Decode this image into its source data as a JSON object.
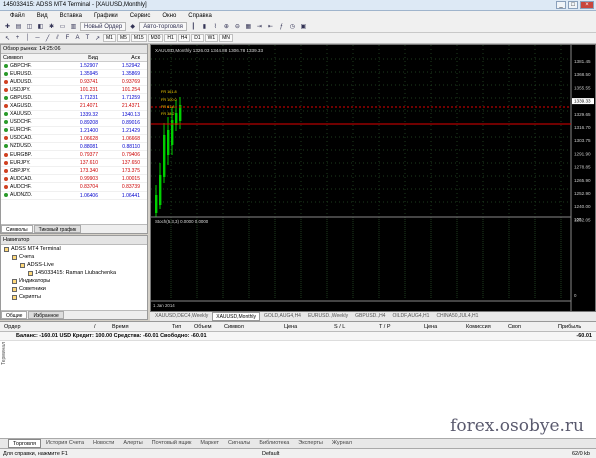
{
  "window": {
    "title": "145033415: ADSS MT4 Terminal - [XAUUSD,Monthly]",
    "buttons": [
      "_",
      "□",
      "×"
    ]
  },
  "menu": [
    "Файл",
    "Вид",
    "Вставка",
    "Графики",
    "Сервис",
    "Окно",
    "Справка"
  ],
  "toolbar": {
    "new_order": "Новый Ордер",
    "autotrade": "Авто-торговля"
  },
  "timeframes": [
    "M1",
    "M5",
    "M15",
    "M30",
    "H1",
    "H4",
    "D1",
    "W1",
    "MN"
  ],
  "market_watch": {
    "title": "Обзор рынка: 14:25:06",
    "headers": [
      "Символ",
      "Бид",
      "Аск"
    ],
    "rows": [
      {
        "sym": "GBPCHF.",
        "bid": "1.52907",
        "ask": "1.52942",
        "dir": "up"
      },
      {
        "sym": "EURUSD.",
        "bid": "1.35945",
        "ask": "1.35869",
        "dir": "up"
      },
      {
        "sym": "AUDUSD.",
        "bid": "0.93741",
        "ask": "0.93769",
        "dir": "dn"
      },
      {
        "sym": "USDJPY.",
        "bid": "101.231",
        "ask": "101.254",
        "dir": "dn"
      },
      {
        "sym": "GBPUSD.",
        "bid": "1.71231",
        "ask": "1.71259",
        "dir": "up"
      },
      {
        "sym": "XAGUSD.",
        "bid": "21.4071",
        "ask": "21.4371",
        "dir": "dn"
      },
      {
        "sym": "XAUUSD.",
        "bid": "1339.32",
        "ask": "1340.13",
        "dir": "up"
      },
      {
        "sym": "USDCHF.",
        "bid": "0.89208",
        "ask": "0.89016",
        "dir": "up"
      },
      {
        "sym": "EURCHF.",
        "bid": "1.21400",
        "ask": "1.21429",
        "dir": "up"
      },
      {
        "sym": "USDCAD.",
        "bid": "1.06628",
        "ask": "1.06668",
        "dir": "dn"
      },
      {
        "sym": "NZDUSD.",
        "bid": "0.88081",
        "ask": "0.88110",
        "dir": "up"
      },
      {
        "sym": "EURGBP.",
        "bid": "0.79377",
        "ask": "0.79406",
        "dir": "dn"
      },
      {
        "sym": "EURJPY.",
        "bid": "137.610",
        "ask": "137.650",
        "dir": "dn"
      },
      {
        "sym": "GBPJPY.",
        "bid": "173.340",
        "ask": "173.375",
        "dir": "dn"
      },
      {
        "sym": "AUDCAD.",
        "bid": "0.99903",
        "ask": "1.00015",
        "dir": "dn"
      },
      {
        "sym": "AUDCHF.",
        "bid": "0.83704",
        "ask": "0.83739",
        "dir": "dn"
      },
      {
        "sym": "AUDNZD.",
        "bid": "1.06406",
        "ask": "1.06441",
        "dir": "up"
      }
    ],
    "tabs": [
      "Символы",
      "Тиковый график"
    ]
  },
  "navigator": {
    "title": "Навигатор",
    "items": [
      {
        "label": "ADSS MT4 Terminal",
        "indent": 0
      },
      {
        "label": "Счета",
        "indent": 1
      },
      {
        "label": "ADSS-Live",
        "indent": 2
      },
      {
        "label": "145033415: Raman Liubachenka",
        "indent": 3
      },
      {
        "label": "Индикаторы",
        "indent": 1
      },
      {
        "label": "Советники",
        "indent": 1
      },
      {
        "label": "Скрипты",
        "indent": 1
      }
    ],
    "tabs": [
      "Общие",
      "Избранное"
    ]
  },
  "chart": {
    "header": "XAUUSD,Monthly 1326.03 1344.88 1306.78 1339.33",
    "indicator_header": "Stoch(5,3,3) 0.0000 0.0000",
    "price_labels": [
      "1381.45",
      "1368.50",
      "1355.55",
      "1339.33",
      "1329.65",
      "1316.70",
      "1303.75",
      "1291.90",
      "1278.85",
      "1265.90",
      "1252.90",
      "1240.00",
      "1232.05"
    ],
    "osc_labels": [
      "100",
      "0"
    ],
    "date_label": "1 Jan 2014",
    "fib_labels": [
      "FR 161.8",
      "FR 100.0",
      "FR 61.8",
      "FR 38.2"
    ]
  },
  "chart_tabs": [
    "XAUUSD,DEC4,Weekly",
    "XAUUSD,Monthly",
    "GOLD,AUG4,H4",
    "EURUSD.,Weekly",
    "GBPUSD.,H4",
    "OILDF,AUG4,H1",
    "CHINA50,JUL4,H1"
  ],
  "terminal": {
    "headers": [
      "Ордер",
      "/",
      "Время",
      "Тип",
      "Объем",
      "Символ",
      "Цена",
      "S / L",
      "T / P",
      "Цена",
      "Комиссия",
      "Своп",
      "Прибыль"
    ],
    "balance": "Баланс: -160.01 USD  Кредит: 100.00  Средства: -60.01  Свободно: -60.01",
    "balance_value": "-60.01",
    "tabs": [
      "Торговля",
      "История Счета",
      "Новости",
      "Алерты",
      "Почтовый ящик",
      "Маркет",
      "Сигналы",
      "Библиотека",
      "Эксперты",
      "Журнал"
    ],
    "side_label": "Терминал"
  },
  "watermark": "forex.osobye.ru",
  "status": {
    "left": "Для справки, нажмите F1",
    "mid": "Default",
    "right": "62/0 kb"
  }
}
